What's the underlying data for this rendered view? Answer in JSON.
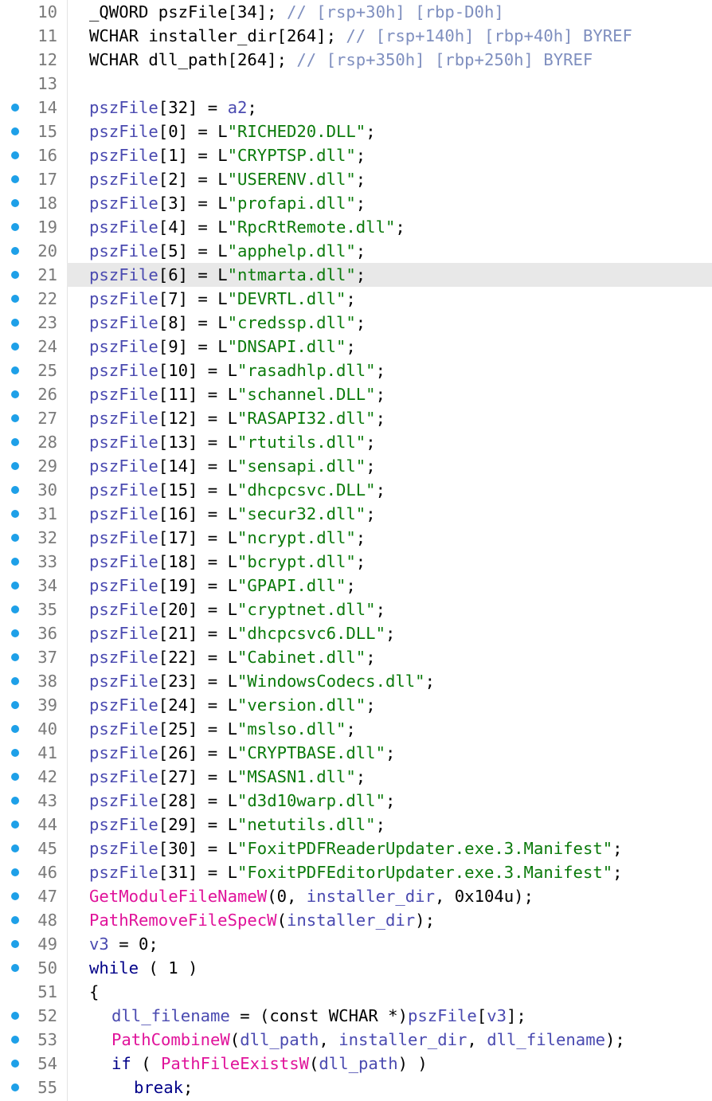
{
  "editor": {
    "highlighted_line": "21",
    "colors": {
      "plain": "#000000",
      "variable": "#4a4ab0",
      "string": "#0b7a0b",
      "function": "#e0139a",
      "comment": "#7f8fbf",
      "keyword": "#000088",
      "gray": "#7a7a7a",
      "breakpoint": "#1ea0e8",
      "highlight": "#e8e8e8"
    },
    "lines": [
      {
        "num": "10",
        "bp": false,
        "indent": 0,
        "tokens": [
          [
            "p",
            "_QWORD pszFile[34]; "
          ],
          [
            "c",
            "// [rsp+30h] [rbp-D0h]"
          ]
        ]
      },
      {
        "num": "11",
        "bp": false,
        "indent": 0,
        "tokens": [
          [
            "p",
            "WCHAR installer_dir[264]; "
          ],
          [
            "c",
            "// [rsp+140h] [rbp+40h] BYREF"
          ]
        ]
      },
      {
        "num": "12",
        "bp": false,
        "indent": 0,
        "tokens": [
          [
            "p",
            "WCHAR dll_path[264]; "
          ],
          [
            "c",
            "// [rsp+350h] [rbp+250h] BYREF"
          ]
        ]
      },
      {
        "num": "13",
        "bp": false,
        "indent": 0,
        "tokens": []
      },
      {
        "num": "14",
        "bp": true,
        "indent": 0,
        "tokens": [
          [
            "v",
            "pszFile"
          ],
          [
            "p",
            "[32] = "
          ],
          [
            "v",
            "a2"
          ],
          [
            "p",
            ";"
          ]
        ]
      },
      {
        "num": "15",
        "bp": true,
        "indent": 0,
        "tokens": [
          [
            "v",
            "pszFile"
          ],
          [
            "p",
            "[0] = L"
          ],
          [
            "s",
            "\"RICHED20.DLL\""
          ],
          [
            "p",
            ";"
          ]
        ]
      },
      {
        "num": "16",
        "bp": true,
        "indent": 0,
        "tokens": [
          [
            "v",
            "pszFile"
          ],
          [
            "p",
            "[1] = L"
          ],
          [
            "s",
            "\"CRYPTSP.dll\""
          ],
          [
            "p",
            ";"
          ]
        ]
      },
      {
        "num": "17",
        "bp": true,
        "indent": 0,
        "tokens": [
          [
            "v",
            "pszFile"
          ],
          [
            "p",
            "[2] = L"
          ],
          [
            "s",
            "\"USERENV.dll\""
          ],
          [
            "p",
            ";"
          ]
        ]
      },
      {
        "num": "18",
        "bp": true,
        "indent": 0,
        "tokens": [
          [
            "v",
            "pszFile"
          ],
          [
            "p",
            "[3] = L"
          ],
          [
            "s",
            "\"profapi.dll\""
          ],
          [
            "p",
            ";"
          ]
        ]
      },
      {
        "num": "19",
        "bp": true,
        "indent": 0,
        "tokens": [
          [
            "v",
            "pszFile"
          ],
          [
            "p",
            "[4] = L"
          ],
          [
            "s",
            "\"RpcRtRemote.dll\""
          ],
          [
            "p",
            ";"
          ]
        ]
      },
      {
        "num": "20",
        "bp": true,
        "indent": 0,
        "tokens": [
          [
            "v",
            "pszFile"
          ],
          [
            "p",
            "[5] = L"
          ],
          [
            "s",
            "\"apphelp.dll\""
          ],
          [
            "p",
            ";"
          ]
        ]
      },
      {
        "num": "21",
        "bp": true,
        "indent": 0,
        "tokens": [
          [
            "v",
            "pszFile"
          ],
          [
            "p",
            "[6] = L"
          ],
          [
            "s",
            "\"ntmarta.dll\""
          ],
          [
            "p",
            ";"
          ]
        ]
      },
      {
        "num": "22",
        "bp": true,
        "indent": 0,
        "tokens": [
          [
            "v",
            "pszFile"
          ],
          [
            "p",
            "[7] = L"
          ],
          [
            "s",
            "\"DEVRTL.dll\""
          ],
          [
            "p",
            ";"
          ]
        ]
      },
      {
        "num": "23",
        "bp": true,
        "indent": 0,
        "tokens": [
          [
            "v",
            "pszFile"
          ],
          [
            "p",
            "[8] = L"
          ],
          [
            "s",
            "\"credssp.dll\""
          ],
          [
            "p",
            ";"
          ]
        ]
      },
      {
        "num": "24",
        "bp": true,
        "indent": 0,
        "tokens": [
          [
            "v",
            "pszFile"
          ],
          [
            "p",
            "[9] = L"
          ],
          [
            "s",
            "\"DNSAPI.dll\""
          ],
          [
            "p",
            ";"
          ]
        ]
      },
      {
        "num": "25",
        "bp": true,
        "indent": 0,
        "tokens": [
          [
            "v",
            "pszFile"
          ],
          [
            "p",
            "[10] = L"
          ],
          [
            "s",
            "\"rasadhlp.dll\""
          ],
          [
            "p",
            ";"
          ]
        ]
      },
      {
        "num": "26",
        "bp": true,
        "indent": 0,
        "tokens": [
          [
            "v",
            "pszFile"
          ],
          [
            "p",
            "[11] = L"
          ],
          [
            "s",
            "\"schannel.DLL\""
          ],
          [
            "p",
            ";"
          ]
        ]
      },
      {
        "num": "27",
        "bp": true,
        "indent": 0,
        "tokens": [
          [
            "v",
            "pszFile"
          ],
          [
            "p",
            "[12] = L"
          ],
          [
            "s",
            "\"RASAPI32.dll\""
          ],
          [
            "p",
            ";"
          ]
        ]
      },
      {
        "num": "28",
        "bp": true,
        "indent": 0,
        "tokens": [
          [
            "v",
            "pszFile"
          ],
          [
            "p",
            "[13] = L"
          ],
          [
            "s",
            "\"rtutils.dll\""
          ],
          [
            "p",
            ";"
          ]
        ]
      },
      {
        "num": "29",
        "bp": true,
        "indent": 0,
        "tokens": [
          [
            "v",
            "pszFile"
          ],
          [
            "p",
            "[14] = L"
          ],
          [
            "s",
            "\"sensapi.dll\""
          ],
          [
            "p",
            ";"
          ]
        ]
      },
      {
        "num": "30",
        "bp": true,
        "indent": 0,
        "tokens": [
          [
            "v",
            "pszFile"
          ],
          [
            "p",
            "[15] = L"
          ],
          [
            "s",
            "\"dhcpcsvc.DLL\""
          ],
          [
            "p",
            ";"
          ]
        ]
      },
      {
        "num": "31",
        "bp": true,
        "indent": 0,
        "tokens": [
          [
            "v",
            "pszFile"
          ],
          [
            "p",
            "[16] = L"
          ],
          [
            "s",
            "\"secur32.dll\""
          ],
          [
            "p",
            ";"
          ]
        ]
      },
      {
        "num": "32",
        "bp": true,
        "indent": 0,
        "tokens": [
          [
            "v",
            "pszFile"
          ],
          [
            "p",
            "[17] = L"
          ],
          [
            "s",
            "\"ncrypt.dll\""
          ],
          [
            "p",
            ";"
          ]
        ]
      },
      {
        "num": "33",
        "bp": true,
        "indent": 0,
        "tokens": [
          [
            "v",
            "pszFile"
          ],
          [
            "p",
            "[18] = L"
          ],
          [
            "s",
            "\"bcrypt.dll\""
          ],
          [
            "p",
            ";"
          ]
        ]
      },
      {
        "num": "34",
        "bp": true,
        "indent": 0,
        "tokens": [
          [
            "v",
            "pszFile"
          ],
          [
            "p",
            "[19] = L"
          ],
          [
            "s",
            "\"GPAPI.dll\""
          ],
          [
            "p",
            ";"
          ]
        ]
      },
      {
        "num": "35",
        "bp": true,
        "indent": 0,
        "tokens": [
          [
            "v",
            "pszFile"
          ],
          [
            "p",
            "[20] = L"
          ],
          [
            "s",
            "\"cryptnet.dll\""
          ],
          [
            "p",
            ";"
          ]
        ]
      },
      {
        "num": "36",
        "bp": true,
        "indent": 0,
        "tokens": [
          [
            "v",
            "pszFile"
          ],
          [
            "p",
            "[21] = L"
          ],
          [
            "s",
            "\"dhcpcsvc6.DLL\""
          ],
          [
            "p",
            ";"
          ]
        ]
      },
      {
        "num": "37",
        "bp": true,
        "indent": 0,
        "tokens": [
          [
            "v",
            "pszFile"
          ],
          [
            "p",
            "[22] = L"
          ],
          [
            "s",
            "\"Cabinet.dll\""
          ],
          [
            "p",
            ";"
          ]
        ]
      },
      {
        "num": "38",
        "bp": true,
        "indent": 0,
        "tokens": [
          [
            "v",
            "pszFile"
          ],
          [
            "p",
            "[23] = L"
          ],
          [
            "s",
            "\"WindowsCodecs.dll\""
          ],
          [
            "p",
            ";"
          ]
        ]
      },
      {
        "num": "39",
        "bp": true,
        "indent": 0,
        "tokens": [
          [
            "v",
            "pszFile"
          ],
          [
            "p",
            "[24] = L"
          ],
          [
            "s",
            "\"version.dll\""
          ],
          [
            "p",
            ";"
          ]
        ]
      },
      {
        "num": "40",
        "bp": true,
        "indent": 0,
        "tokens": [
          [
            "v",
            "pszFile"
          ],
          [
            "p",
            "[25] = L"
          ],
          [
            "s",
            "\"mslso.dll\""
          ],
          [
            "p",
            ";"
          ]
        ]
      },
      {
        "num": "41",
        "bp": true,
        "indent": 0,
        "tokens": [
          [
            "v",
            "pszFile"
          ],
          [
            "p",
            "[26] = L"
          ],
          [
            "s",
            "\"CRYPTBASE.dll\""
          ],
          [
            "p",
            ";"
          ]
        ]
      },
      {
        "num": "42",
        "bp": true,
        "indent": 0,
        "tokens": [
          [
            "v",
            "pszFile"
          ],
          [
            "p",
            "[27] = L"
          ],
          [
            "s",
            "\"MSASN1.dll\""
          ],
          [
            "p",
            ";"
          ]
        ]
      },
      {
        "num": "43",
        "bp": true,
        "indent": 0,
        "tokens": [
          [
            "v",
            "pszFile"
          ],
          [
            "p",
            "[28] = L"
          ],
          [
            "s",
            "\"d3d10warp.dll\""
          ],
          [
            "p",
            ";"
          ]
        ]
      },
      {
        "num": "44",
        "bp": true,
        "indent": 0,
        "tokens": [
          [
            "v",
            "pszFile"
          ],
          [
            "p",
            "[29] = L"
          ],
          [
            "s",
            "\"netutils.dll\""
          ],
          [
            "p",
            ";"
          ]
        ]
      },
      {
        "num": "45",
        "bp": true,
        "indent": 0,
        "tokens": [
          [
            "v",
            "pszFile"
          ],
          [
            "p",
            "[30] = L"
          ],
          [
            "s",
            "\"FoxitPDFReaderUpdater.exe.3.Manifest\""
          ],
          [
            "p",
            ";"
          ]
        ]
      },
      {
        "num": "46",
        "bp": true,
        "indent": 0,
        "tokens": [
          [
            "v",
            "pszFile"
          ],
          [
            "p",
            "[31] = L"
          ],
          [
            "s",
            "\"FoxitPDFEditorUpdater.exe.3.Manifest\""
          ],
          [
            "p",
            ";"
          ]
        ]
      },
      {
        "num": "47",
        "bp": true,
        "indent": 0,
        "tokens": [
          [
            "f",
            "GetModuleFileNameW"
          ],
          [
            "p",
            "(0, "
          ],
          [
            "v",
            "installer_dir"
          ],
          [
            "p",
            ", 0x104u);"
          ]
        ]
      },
      {
        "num": "48",
        "bp": true,
        "indent": 0,
        "tokens": [
          [
            "f",
            "PathRemoveFileSpecW"
          ],
          [
            "p",
            "("
          ],
          [
            "v",
            "installer_dir"
          ],
          [
            "p",
            ");"
          ]
        ]
      },
      {
        "num": "49",
        "bp": true,
        "indent": 0,
        "tokens": [
          [
            "v",
            "v3"
          ],
          [
            "p",
            " = 0;"
          ]
        ]
      },
      {
        "num": "50",
        "bp": true,
        "indent": 0,
        "tokens": [
          [
            "k",
            "while"
          ],
          [
            "p",
            " ( 1 )"
          ]
        ]
      },
      {
        "num": "51",
        "bp": false,
        "indent": 0,
        "tokens": [
          [
            "p",
            "{"
          ]
        ]
      },
      {
        "num": "52",
        "bp": true,
        "indent": 1,
        "tokens": [
          [
            "v",
            "dll_filename"
          ],
          [
            "p",
            " = (const WCHAR *)"
          ],
          [
            "v",
            "pszFile"
          ],
          [
            "p",
            "["
          ],
          [
            "v",
            "v3"
          ],
          [
            "p",
            "];"
          ]
        ]
      },
      {
        "num": "53",
        "bp": true,
        "indent": 1,
        "tokens": [
          [
            "f",
            "PathCombineW"
          ],
          [
            "p",
            "("
          ],
          [
            "v",
            "dll_path"
          ],
          [
            "p",
            ", "
          ],
          [
            "v",
            "installer_dir"
          ],
          [
            "p",
            ", "
          ],
          [
            "v",
            "dll_filename"
          ],
          [
            "p",
            ");"
          ]
        ]
      },
      {
        "num": "54",
        "bp": true,
        "indent": 1,
        "tokens": [
          [
            "k",
            "if"
          ],
          [
            "p",
            " ( "
          ],
          [
            "f",
            "PathFileExistsW"
          ],
          [
            "p",
            "("
          ],
          [
            "v",
            "dll_path"
          ],
          [
            "p",
            ") )"
          ]
        ]
      },
      {
        "num": "55",
        "bp": true,
        "indent": 2,
        "tokens": [
          [
            "k",
            "break"
          ],
          [
            "p",
            ";"
          ]
        ]
      }
    ]
  }
}
